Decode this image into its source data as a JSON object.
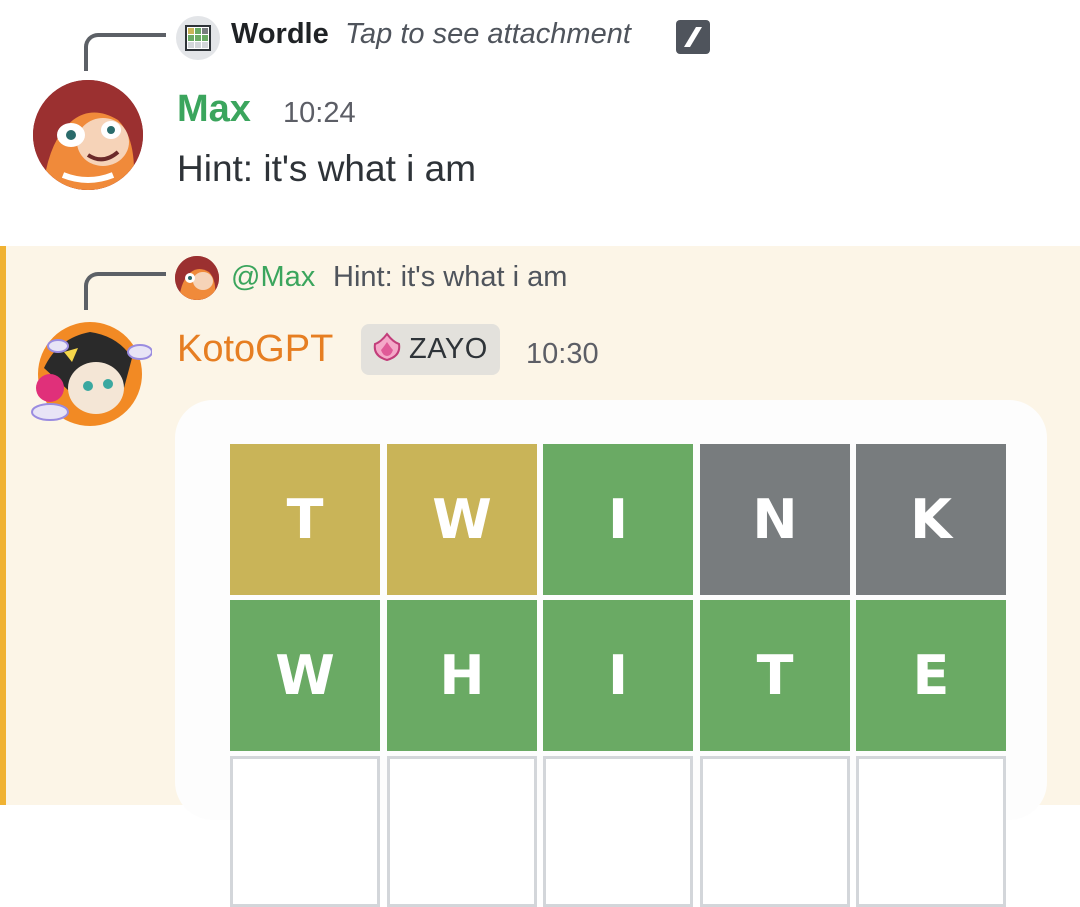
{
  "first_message": {
    "reply": {
      "app_name": "Wordle",
      "preview": "Tap to see attachment",
      "icon": "wordle-grid-icon",
      "attachment_icon": "slash-icon"
    },
    "author": "Max",
    "author_color": "#3ba55d",
    "time": "10:24",
    "text": "Hint: it's what i am"
  },
  "second_message": {
    "highlight_color": "#fcf5e7",
    "highlight_bar_color": "#f0b232",
    "reply": {
      "mention": "@Max",
      "preview": "Hint: it's what i am"
    },
    "author": "KotoGPT",
    "author_color": "#e67e22",
    "role_badge": {
      "icon": "pink-flame-icon",
      "label": "ZAYO"
    },
    "time": "10:30",
    "wordle": {
      "colors": {
        "correct": "#6aaa64",
        "present": "#c9b458",
        "absent": "#787c7e"
      },
      "rows": [
        [
          {
            "letter": "T",
            "state": "present"
          },
          {
            "letter": "W",
            "state": "present"
          },
          {
            "letter": "I",
            "state": "correct"
          },
          {
            "letter": "N",
            "state": "absent"
          },
          {
            "letter": "K",
            "state": "absent"
          }
        ],
        [
          {
            "letter": "W",
            "state": "correct"
          },
          {
            "letter": "H",
            "state": "correct"
          },
          {
            "letter": "I",
            "state": "correct"
          },
          {
            "letter": "T",
            "state": "correct"
          },
          {
            "letter": "E",
            "state": "correct"
          }
        ],
        [
          {
            "letter": "",
            "state": "empty"
          },
          {
            "letter": "",
            "state": "empty"
          },
          {
            "letter": "",
            "state": "empty"
          },
          {
            "letter": "",
            "state": "empty"
          },
          {
            "letter": "",
            "state": "empty"
          }
        ]
      ]
    }
  }
}
